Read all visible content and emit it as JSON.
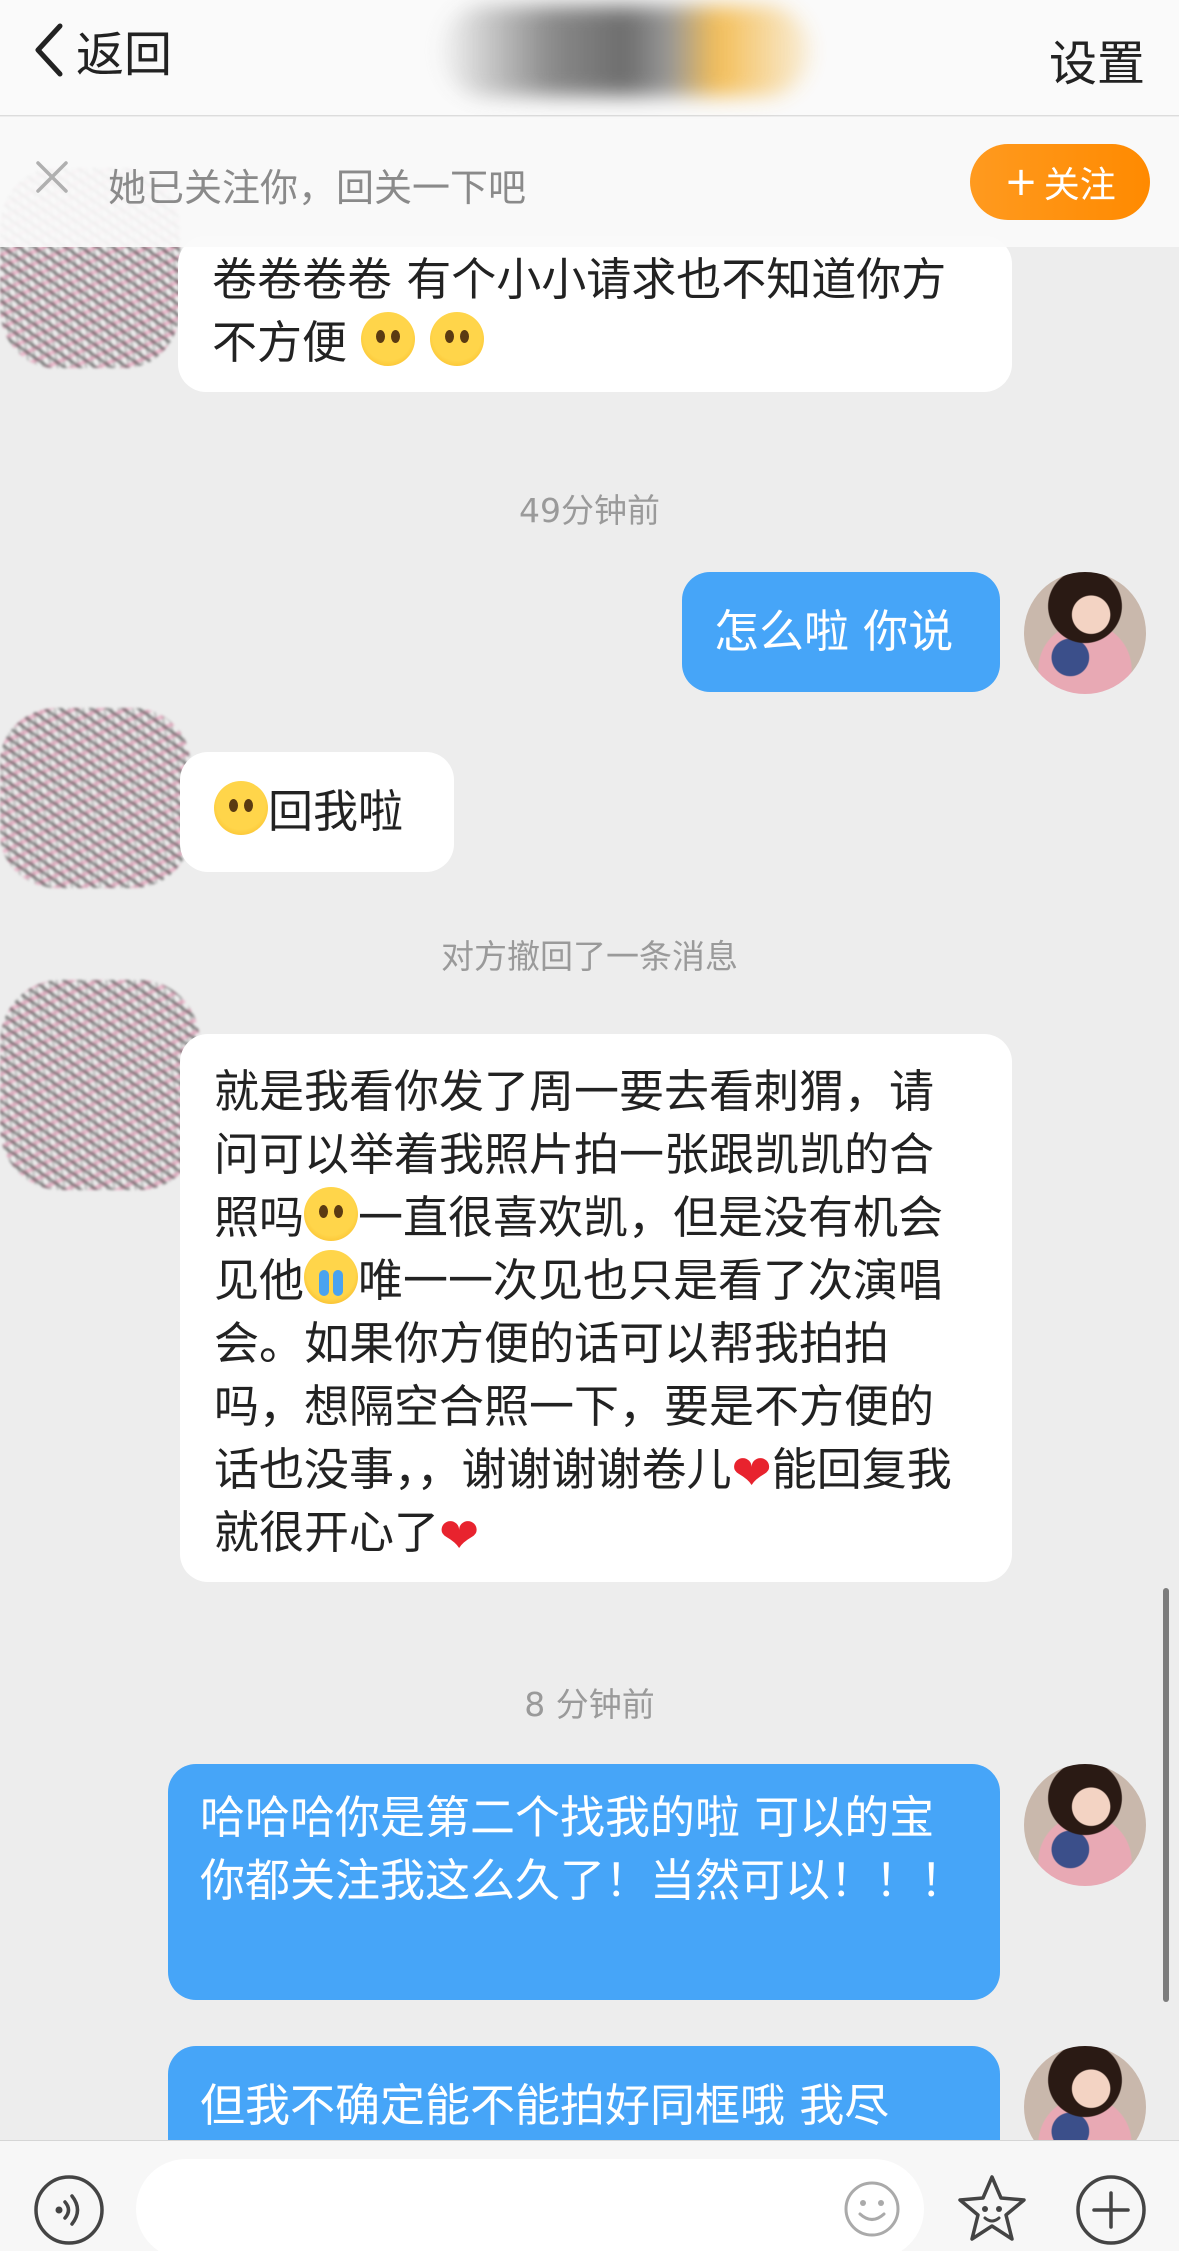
{
  "nav": {
    "back_label": "返回",
    "settings_label": "设置"
  },
  "follow_banner": {
    "text": "她已关注你，回关一下吧",
    "button_label": "关注",
    "button_color": "#ff8a00"
  },
  "messages": [
    {
      "type": "text",
      "side": "in",
      "text": "卷卷卷卷 有个小小请求也不知道你方不方便",
      "emojis": [
        "pleading-emoji",
        "pleading-emoji"
      ]
    },
    {
      "type": "timestamp",
      "text": "49分钟前"
    },
    {
      "type": "text",
      "side": "out",
      "text": "怎么啦 你说"
    },
    {
      "type": "text",
      "side": "in",
      "text": "回我啦",
      "emojis": [
        "kiss-emoji"
      ]
    },
    {
      "type": "notice",
      "text": "对方撤回了一条消息"
    },
    {
      "type": "text",
      "side": "in",
      "segments": [
        "就是我看你发了周一要去看刺猬，请问可以举着我照片拍一张跟凯凯的合照吗",
        "一直很喜欢凯，但是没有机会见他",
        "唯一一次见也只是看了次演唱会。如果你方便的话可以帮我拍拍吗，想隔空合照一下，要是不方便的话也没事，，谢谢谢谢卷儿",
        "能回复我就很开心了"
      ],
      "emojis": [
        "pleading-emoji",
        "crying-emoji",
        "red-heart",
        "red-heart"
      ]
    },
    {
      "type": "timestamp",
      "text": "8 分钟前"
    },
    {
      "type": "text",
      "side": "out",
      "text": "哈哈哈你是第二个找我的啦 可以的宝 你都关注我这么久了！当然可以！！！"
    },
    {
      "type": "text",
      "side": "out",
      "text": "但我不确定能不能拍好同框哦 我尽"
    }
  ],
  "colors": {
    "outgoing_bubble": "#46a5f8",
    "incoming_bubble": "#ffffff",
    "background": "#ededed"
  },
  "input_bar": {
    "icons": [
      "voice-icon",
      "emoji-face-icon",
      "star-sticker-icon",
      "plus-icon"
    ]
  }
}
